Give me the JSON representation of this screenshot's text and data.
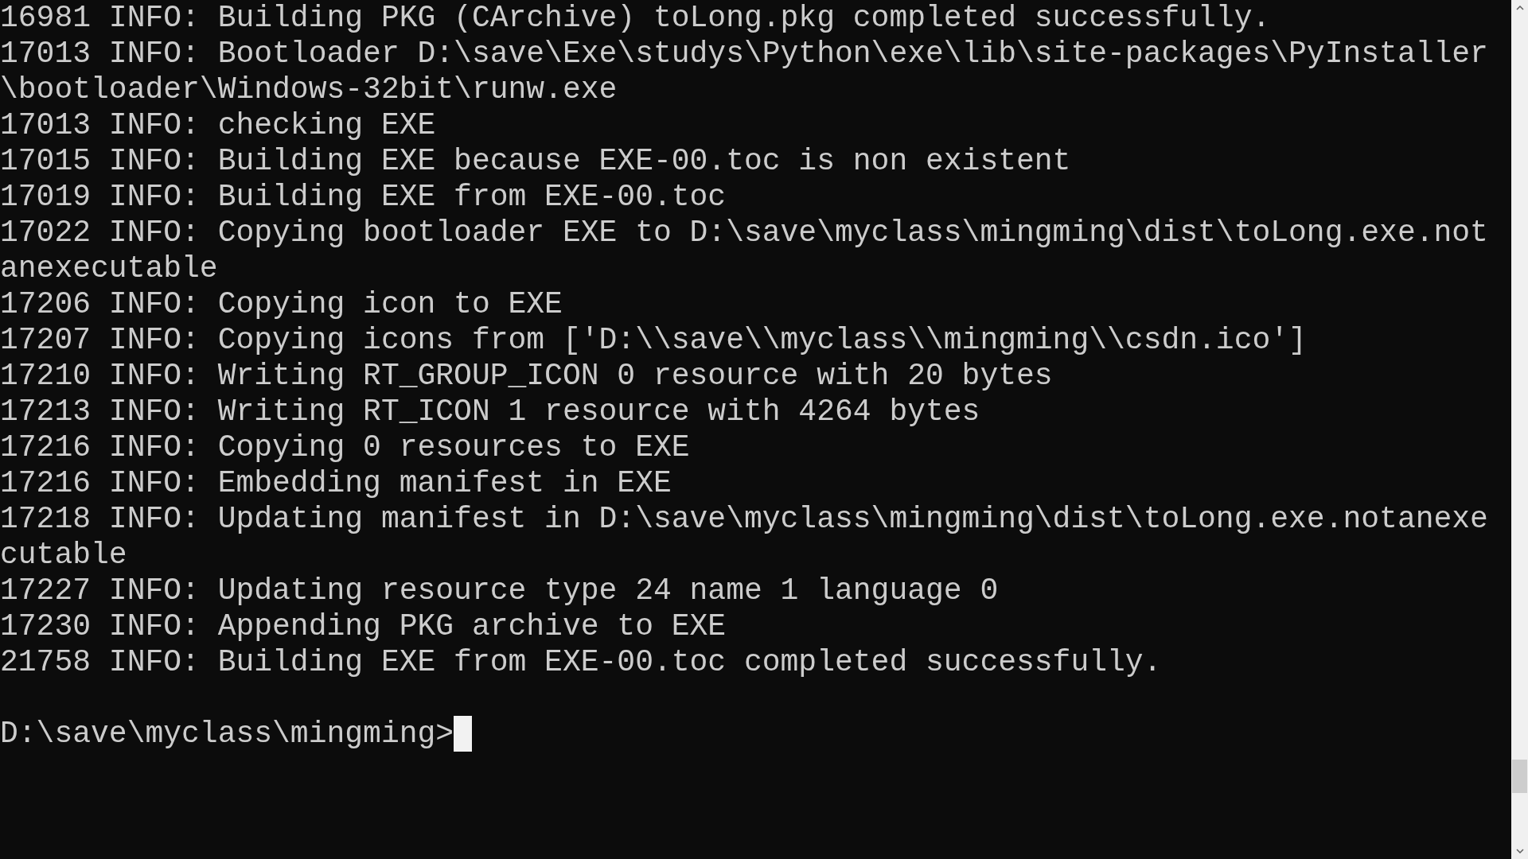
{
  "console": {
    "lines": [
      "16981 INFO: Building PKG (CArchive) toLong.pkg completed successfully.",
      "17013 INFO: Bootloader D:\\save\\Exe\\studys\\Python\\exe\\lib\\site-packages\\PyInstaller",
      "\\bootloader\\Windows-32bit\\runw.exe",
      "17013 INFO: checking EXE",
      "17015 INFO: Building EXE because EXE-00.toc is non existent",
      "17019 INFO: Building EXE from EXE-00.toc",
      "17022 INFO: Copying bootloader EXE to D:\\save\\myclass\\mingming\\dist\\toLong.exe.not",
      "anexecutable",
      "17206 INFO: Copying icon to EXE",
      "17207 INFO: Copying icons from ['D:\\\\save\\\\myclass\\\\mingming\\\\csdn.ico']",
      "17210 INFO: Writing RT_GROUP_ICON 0 resource with 20 bytes",
      "17213 INFO: Writing RT_ICON 1 resource with 4264 bytes",
      "17216 INFO: Copying 0 resources to EXE",
      "17216 INFO: Embedding manifest in EXE",
      "17218 INFO: Updating manifest in D:\\save\\myclass\\mingming\\dist\\toLong.exe.notanexe",
      "cutable",
      "17227 INFO: Updating resource type 24 name 1 language 0",
      "17230 INFO: Appending PKG archive to EXE",
      "21758 INFO: Building EXE from EXE-00.toc completed successfully."
    ],
    "prompt": "D:\\save\\myclass\\mingming>"
  }
}
